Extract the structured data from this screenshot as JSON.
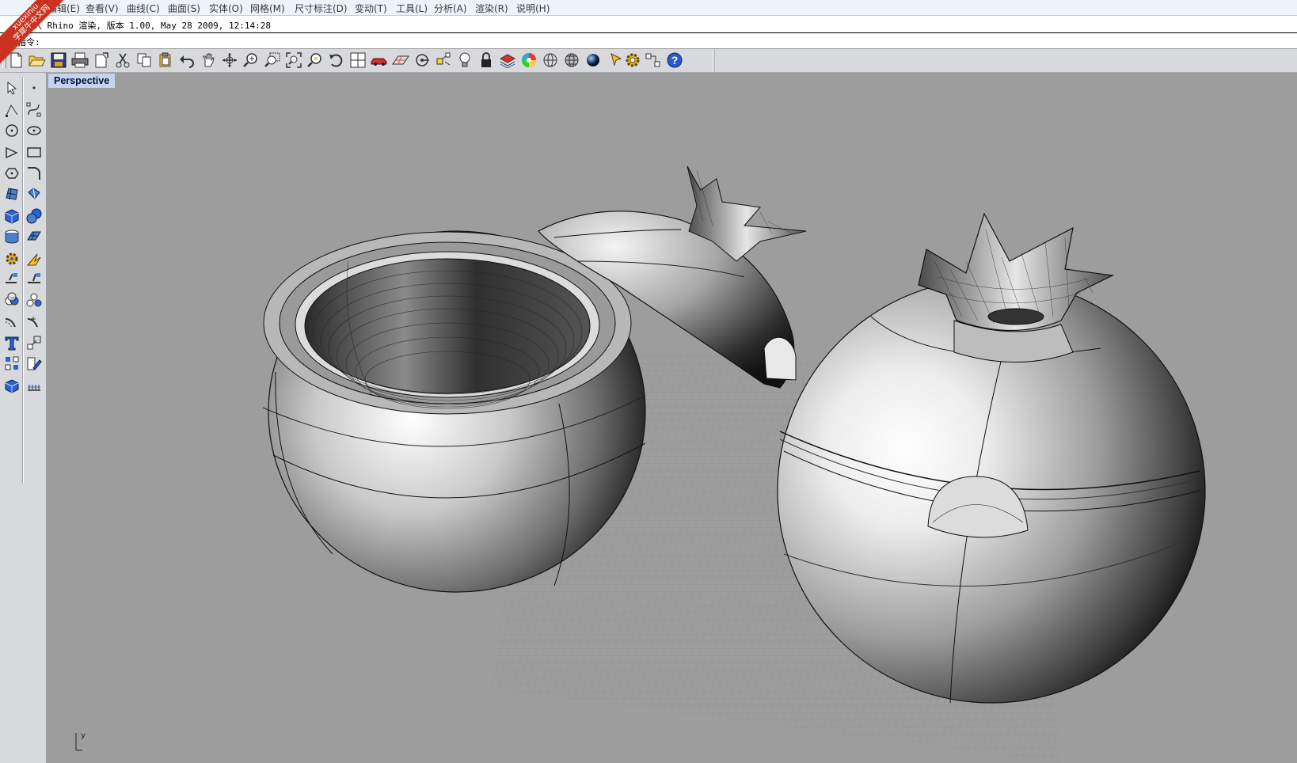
{
  "app": {
    "watermark_line1": "xuexiniu",
    "watermark_line2": "学犀牛中文网"
  },
  "menu": [
    {
      "label": "编辑(E)"
    },
    {
      "label": "查看(V)"
    },
    {
      "label": "曲线(C)"
    },
    {
      "label": "曲面(S)"
    },
    {
      "label": "实体(O)"
    },
    {
      "label": "网格(M)"
    },
    {
      "label": "尺寸标注(D)"
    },
    {
      "label": "变动(T)"
    },
    {
      "label": "工具(L)"
    },
    {
      "label": "分析(A)"
    },
    {
      "label": "渲染(R)"
    },
    {
      "label": "说明(H)"
    }
  ],
  "command": {
    "history": "载入 Rhino 渲染, 版本 1.00, May 28 2009, 12:14:28",
    "prompt": "指令:"
  },
  "toolbar": {
    "buttons": [
      "new-icon",
      "open-icon",
      "save-icon",
      "print-icon",
      "import-icon",
      "cut-icon",
      "copy-icon",
      "paste-icon",
      "undo-icon",
      "pan-icon",
      "rotate-view-icon",
      "zoom-icon",
      "zoom-window-icon",
      "zoom-extents-icon",
      "zoom-selected-icon",
      "undo-view-icon",
      "viewport-layout-icon",
      "car-icon",
      "grid-plane-icon",
      "cplane-icon",
      "osnap-icon",
      "light-icon",
      "lock-icon",
      "layer-icon",
      "color-wheel-icon",
      "wireframe-icon",
      "shaded-icon",
      "render-icon",
      "pointer-icon",
      "gear-icon",
      "options-icon",
      "help-icon"
    ]
  },
  "left_toolbar": {
    "buttons": [
      [
        "select-icon",
        "point-icon"
      ],
      [
        "polyline-icon",
        "curve-icon"
      ],
      [
        "circle-icon",
        "ellipse-icon"
      ],
      [
        "arc-icon",
        "rectangle-icon"
      ],
      [
        "polygon-icon",
        "fillet-icon"
      ],
      [
        "surface-icon",
        "extrude-icon"
      ],
      [
        "box-icon",
        "sphere-icon"
      ],
      [
        "cylinder-icon",
        "plane-icon"
      ],
      [
        "gear-icon",
        "explode-icon"
      ],
      [
        "trim-icon",
        "split-icon"
      ],
      [
        "boolean-icon",
        "group-icon"
      ],
      [
        "offset-icon",
        "rebuild-icon"
      ],
      [
        "text-icon",
        "scale-icon"
      ],
      [
        "array-icon",
        "edit-icon"
      ],
      [
        "mesh-icon",
        "dimension-icon"
      ]
    ]
  },
  "viewport": {
    "title": "Perspective",
    "axis_label": "y",
    "colors": {
      "background": "#9d9d9d",
      "grid": "#8f8f8f",
      "title_bg": "#c4d4ee"
    }
  }
}
